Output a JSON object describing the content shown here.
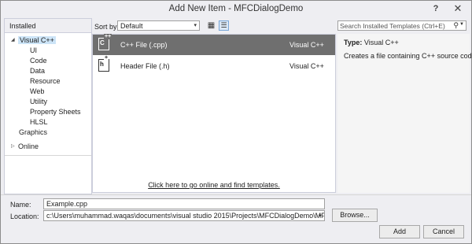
{
  "window": {
    "title": "Add New Item - MFCDialogDemo",
    "help_label": "?",
    "close_label": "✕"
  },
  "tree": {
    "header": "Installed",
    "root_label": "Visual C++",
    "children": [
      "UI",
      "Code",
      "Data",
      "Resource",
      "Web",
      "Utility",
      "Property Sheets",
      "HLSL"
    ],
    "graphics_label": "Graphics",
    "online_label": "Online",
    "expanded_arrow": "◢",
    "collapsed_arrow": "▷"
  },
  "toolbar": {
    "sort_label": "Sort by:",
    "sort_value": "Default",
    "sort_caret": "▾",
    "grid_view_icon": "grid-view-icon",
    "list_view_icon": "list-view-icon"
  },
  "search": {
    "placeholder": "Search Installed Templates (Ctrl+E)",
    "icon": "search-icon"
  },
  "templates": [
    {
      "name": "C++ File (.cpp)",
      "language": "Visual C++",
      "icon": "cpp-file-icon",
      "selected": true
    },
    {
      "name": "Header File (.h)",
      "language": "Visual C++",
      "icon": "header-file-icon",
      "selected": false
    }
  ],
  "online_link": "Click here to go online and find templates.",
  "details": {
    "type_label": "Type:",
    "type_value": "Visual C++",
    "description": "Creates a file containing C++ source code"
  },
  "form": {
    "name_label": "Name:",
    "name_value": "Example.cpp",
    "location_label": "Location:",
    "location_value": "c:\\Users\\muhammad.waqas\\documents\\visual studio 2015\\Projects\\MFCDialogDemo\\MFCDialog",
    "browse_label": "Browse...",
    "add_label": "Add",
    "cancel_label": "Cancel"
  }
}
